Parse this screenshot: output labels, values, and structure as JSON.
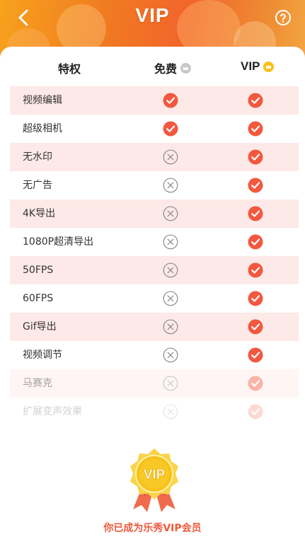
{
  "header": {
    "title": "VIP",
    "back_icon": "chevron-left-icon",
    "help_icon": "question-circle-icon"
  },
  "table": {
    "headers": {
      "privilege": "特权",
      "free": "免费",
      "vip": "VIP"
    },
    "rows": [
      {
        "name": "视频编辑",
        "free": true,
        "vip": true
      },
      {
        "name": "超级相机",
        "free": true,
        "vip": true
      },
      {
        "name": "无水印",
        "free": false,
        "vip": true
      },
      {
        "name": "无广告",
        "free": false,
        "vip": true
      },
      {
        "name": "4K导出",
        "free": false,
        "vip": true
      },
      {
        "name": "1080P超清导出",
        "free": false,
        "vip": true
      },
      {
        "name": "50FPS",
        "free": false,
        "vip": true
      },
      {
        "name": "60FPS",
        "free": false,
        "vip": true
      },
      {
        "name": "Gif导出",
        "free": false,
        "vip": true
      },
      {
        "name": "视频调节",
        "free": false,
        "vip": true
      },
      {
        "name": "马赛克",
        "free": false,
        "vip": true
      },
      {
        "name": "扩展变声效果",
        "free": false,
        "vip": true
      }
    ]
  },
  "medal": {
    "label": "VIP"
  },
  "status_text": "你已成为乐秀VIP会员",
  "colors": {
    "accent": "#f2583f",
    "stripe": "#fde9e7",
    "status_text": "#ee5a3d",
    "gold": "#f6c21a"
  }
}
